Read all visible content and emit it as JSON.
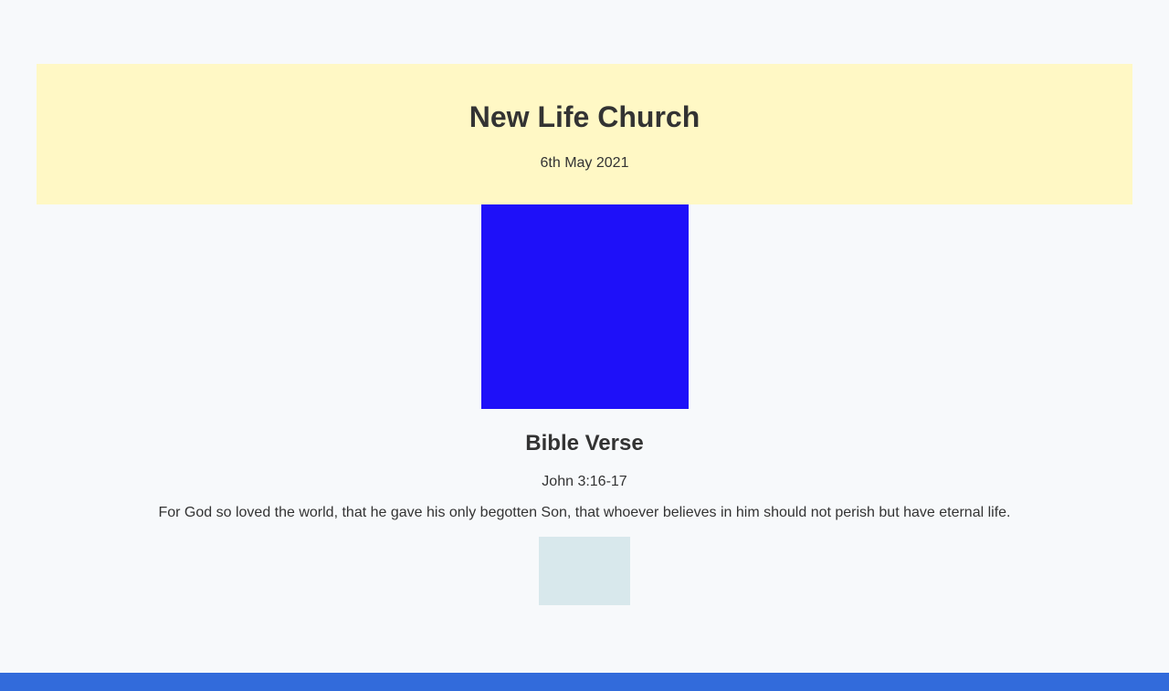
{
  "header": {
    "title": "New Life Church",
    "date": "6th May 2021"
  },
  "verse": {
    "heading": "Bible Verse",
    "reference": "John 3:16-17",
    "text": "For God so loved the world, that he gave his only begotten Son, that whoever believes in him should not perish but have eternal life."
  },
  "colors": {
    "header_bg": "#fff8c5",
    "main_image": "#1e10f9",
    "small_image": "#d8e8ec",
    "footer": "#326bdb"
  }
}
